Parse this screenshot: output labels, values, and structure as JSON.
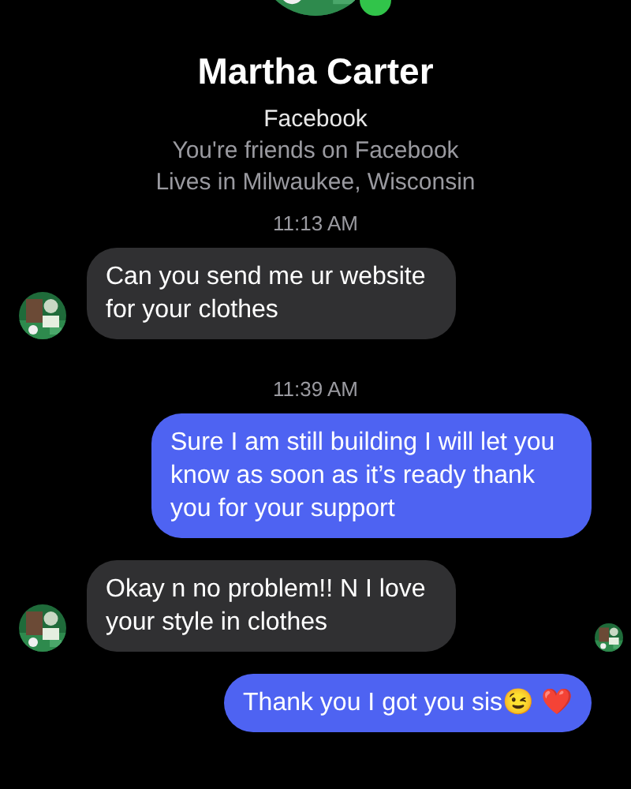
{
  "profile": {
    "name": "Martha Carter",
    "online": true,
    "lines": [
      "Facebook",
      "You're friends on Facebook",
      "Lives in Milwaukee, Wisconsin"
    ]
  },
  "thread": [
    {
      "kind": "time",
      "text": "11:13 AM"
    },
    {
      "kind": "incoming",
      "text": "Can you send me ur website for your clothes",
      "seen": false
    },
    {
      "kind": "time",
      "text": "11:39 AM"
    },
    {
      "kind": "outgoing",
      "text": "Sure I am still building I will let you know as soon as it’s ready thank you for your support",
      "seen": false
    },
    {
      "kind": "incoming",
      "text": "Okay n no problem!! N I love your style in clothes",
      "seen": true
    },
    {
      "kind": "outgoing",
      "text": "Thank you I got you sis😉 ❤️",
      "seen": false
    }
  ]
}
